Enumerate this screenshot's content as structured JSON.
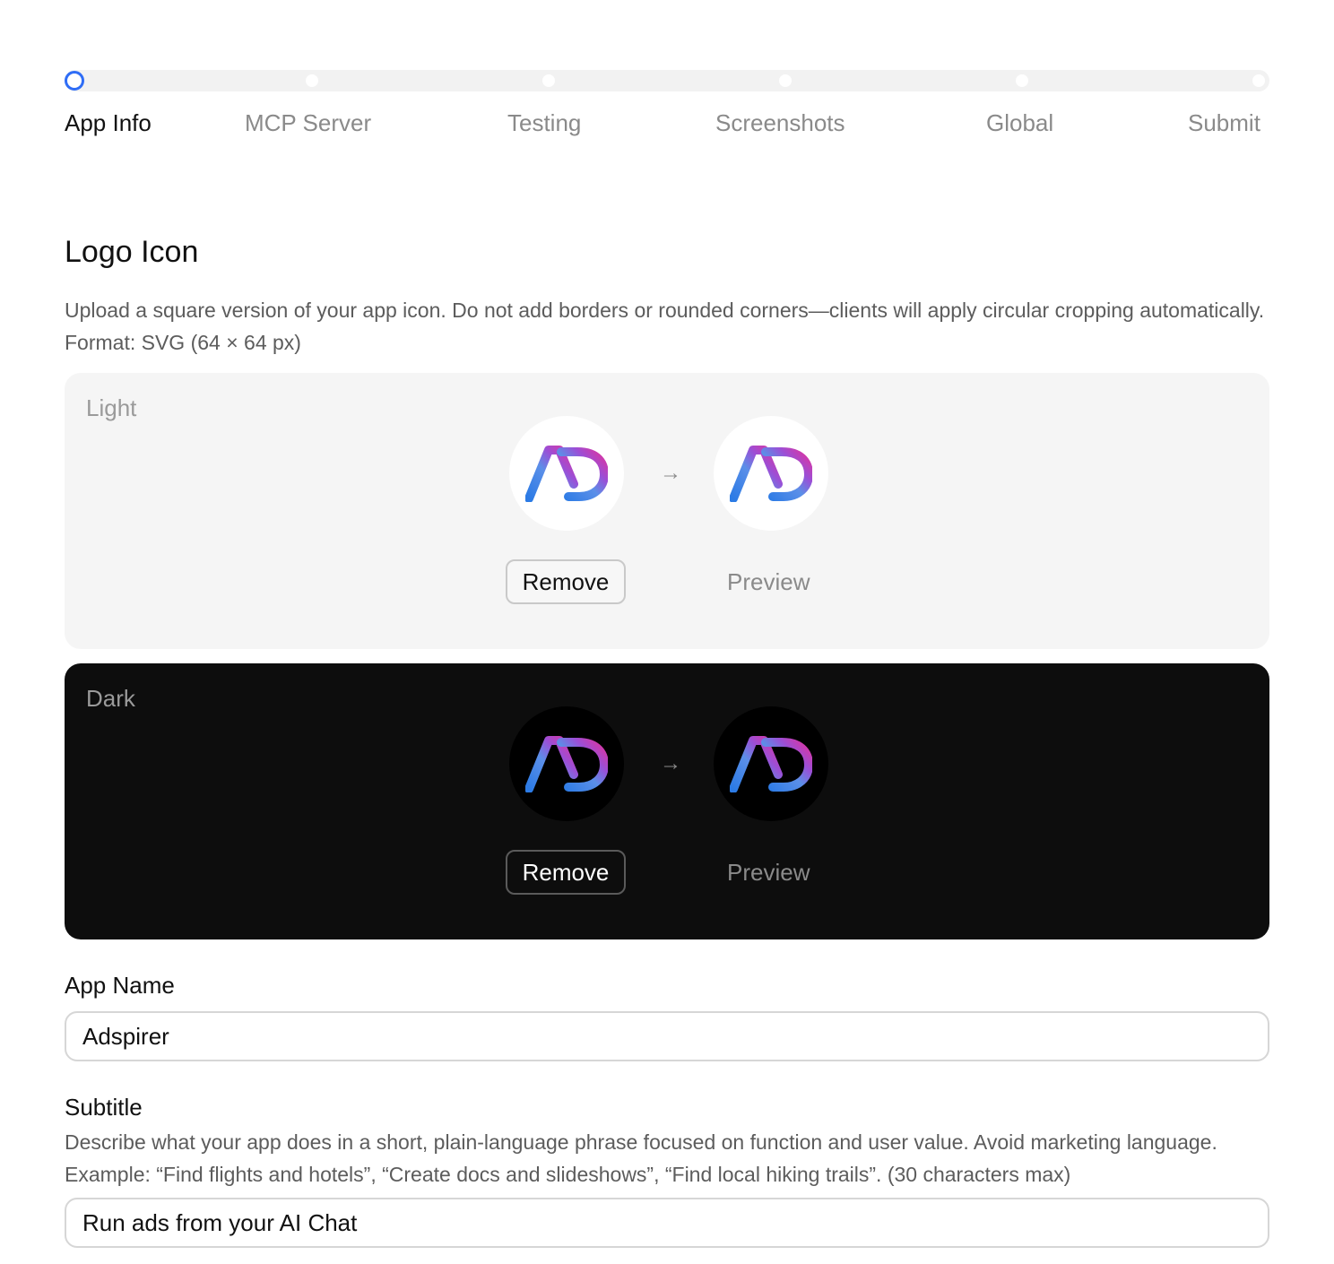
{
  "stepper": {
    "steps": [
      {
        "label": "App Info",
        "active": true
      },
      {
        "label": "MCP Server",
        "active": false
      },
      {
        "label": "Testing",
        "active": false
      },
      {
        "label": "Screenshots",
        "active": false
      },
      {
        "label": "Global",
        "active": false
      },
      {
        "label": "Submit",
        "active": false
      }
    ],
    "active_color": "#2f6df6"
  },
  "logo_section": {
    "title": "Logo Icon",
    "description": "Upload a square version of your app icon. Do not add borders or rounded corners—clients will apply circular cropping automatically. Format: SVG (64 × 64 px)",
    "light": {
      "label": "Light",
      "remove_label": "Remove",
      "preview_label": "Preview",
      "arrow": "→"
    },
    "dark": {
      "label": "Dark",
      "remove_label": "Remove",
      "preview_label": "Preview",
      "arrow": "→"
    },
    "logo_icon": "adspirer-ad-logo-icon"
  },
  "app_name": {
    "label": "App Name",
    "value": "Adspirer"
  },
  "subtitle": {
    "label": "Subtitle",
    "description": "Describe what your app does in a short, plain-language phrase focused on function and user value. Avoid marketing language. Example: “Find flights and hotels”, “Create docs and slideshows”, “Find local hiking trails”. (30 characters max)",
    "value": "Run ads from your AI Chat"
  }
}
